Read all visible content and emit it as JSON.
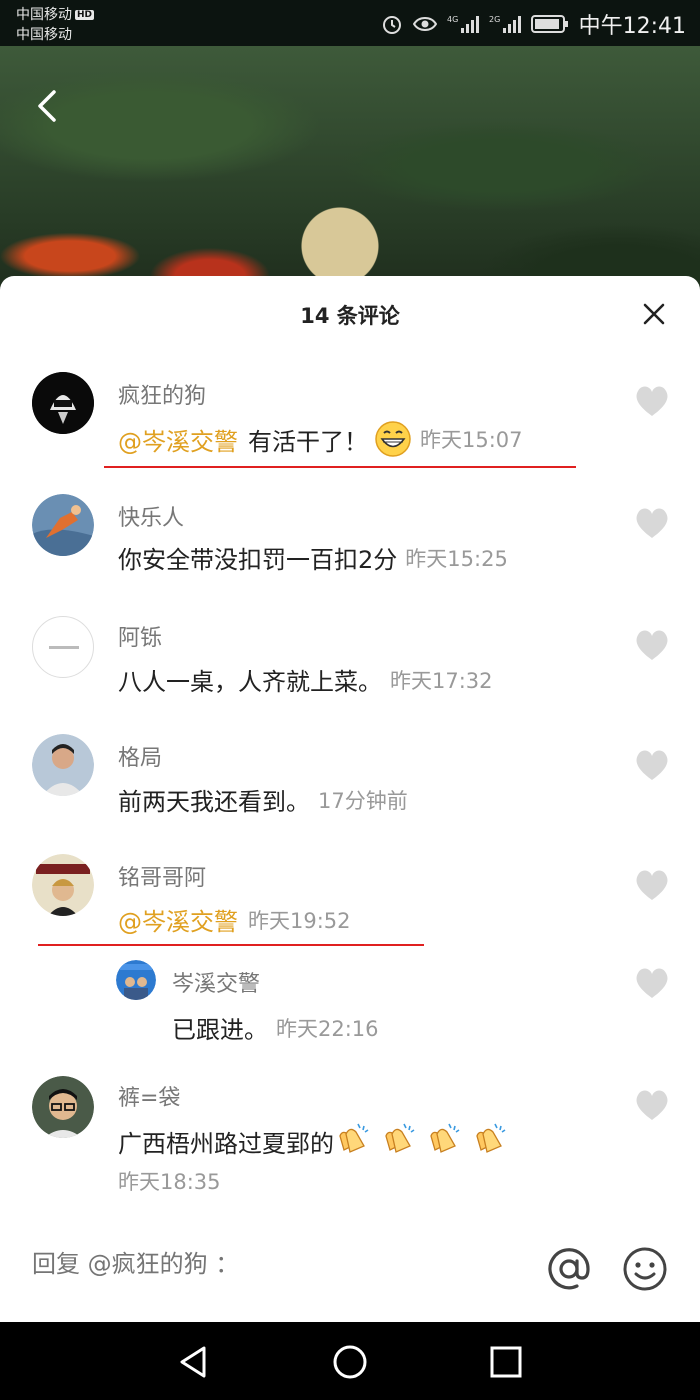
{
  "status_bar": {
    "carrier1": "中国移动",
    "hd_badge": "HD",
    "carrier2": "中国移动",
    "time": "中午12:41",
    "icons": [
      "alarm-icon",
      "eye-icon",
      "signal-4g-icon",
      "signal-2g-icon",
      "battery-icon"
    ]
  },
  "sheet": {
    "title": "14 条评论"
  },
  "comments": [
    {
      "user": "疯狂的狗",
      "mention": "@岑溪交警",
      "text": "有活干了！",
      "emoji": "grinning-face",
      "time": "昨天15:07",
      "avatar": "helmet-avatar"
    },
    {
      "user": "快乐人",
      "text": "你安全带没扣罚一百扣2分",
      "time": "昨天15:25",
      "avatar": "swimmer-avatar"
    },
    {
      "user": "阿铄",
      "text": "八人一桌，人齐就上菜。",
      "time": "昨天17:32",
      "avatar": "white-logo-avatar"
    },
    {
      "user": "格局",
      "text": "前两天我还看到。",
      "time": "17分钟前",
      "avatar": "man-photo-avatar"
    },
    {
      "user": "铭哥哥阿",
      "mention": "@岑溪交警",
      "text": "",
      "time": "昨天19:52",
      "avatar": "poster-avatar"
    },
    {
      "user": "岑溪交警",
      "text": "已跟进。",
      "time": "昨天22:16",
      "avatar": "police-avatar",
      "is_reply": true
    },
    {
      "user": "裤=袋",
      "text": "广西梧州路过夏郢的",
      "emoji": "clapping-hands x4",
      "time": "昨天18:35",
      "avatar": "glasses-man-avatar"
    }
  ],
  "reply_bar": {
    "placeholder": "回复 @疯狂的狗 ："
  },
  "nav": {
    "icons": [
      "back-triangle-icon",
      "home-circle-icon",
      "recents-square-icon"
    ]
  },
  "colors": {
    "mention": "#e0a020",
    "underline": "#e02020",
    "like": "#d8d8d8"
  }
}
